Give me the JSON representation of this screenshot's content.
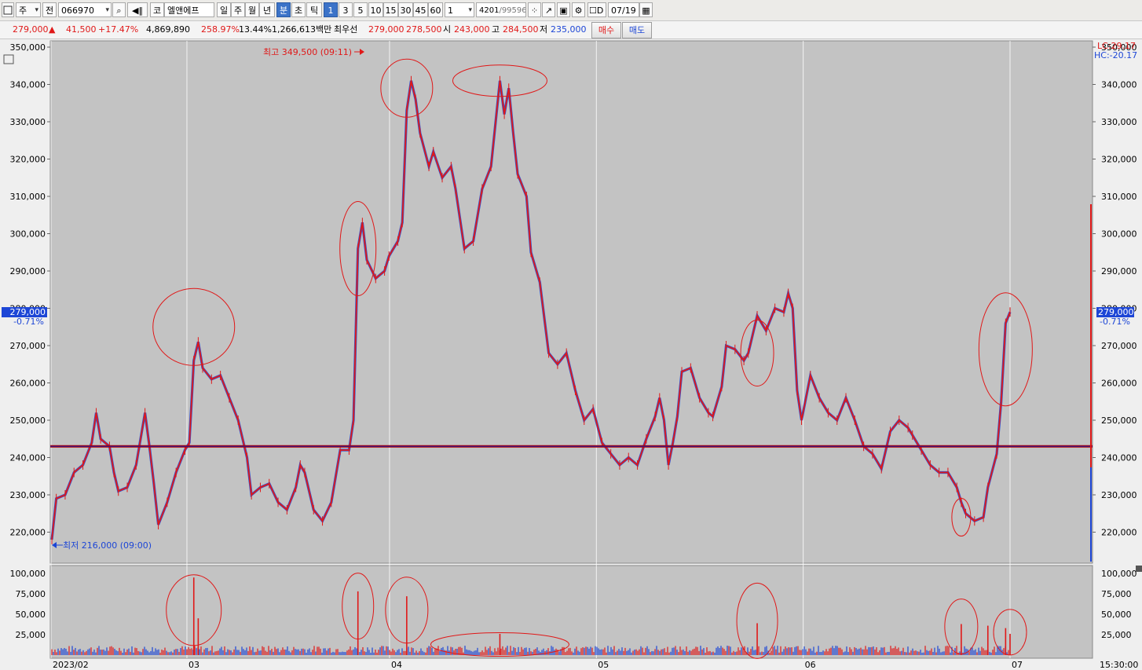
{
  "toolbar": {
    "items": [
      "주",
      "전",
      "066970",
      "코",
      "엘앤에프",
      "일",
      "주",
      "월",
      "년",
      "분",
      "초",
      "틱",
      "1",
      "3",
      "5",
      "10",
      "15",
      "30",
      "45",
      "60",
      "1",
      "4201",
      "/99596",
      "D",
      "07/19"
    ]
  },
  "quote": {
    "price": "279,000",
    "change": "41,500",
    "change_pct": "+17.47%",
    "volume": "4,869,890",
    "vol_ratio": "258.97%",
    "turnover": "13.44%",
    "amount": "1,266,613백만",
    "best_ask_label": "최우선",
    "best_ask": "279,000",
    "best_bid": "278,500",
    "open_label": "시",
    "open": "243,000",
    "high_label": "고",
    "high": "284,500",
    "low_label": "저",
    "low": "235,000",
    "buy_label": "매수",
    "sell_label": "매도"
  },
  "colors": {
    "up": "#e01818",
    "down": "#1d46d6",
    "plot_bg": "#c3c3c3",
    "baseline": "#b00000"
  },
  "chart_data": {
    "type": "line",
    "price_ticks": [
      "350,000",
      "340,000",
      "330,000",
      "320,000",
      "310,000",
      "300,000",
      "290,000",
      "280,000",
      "270,000",
      "260,000",
      "250,000",
      "240,000",
      "230,000",
      "220,000"
    ],
    "volume_ticks": [
      "100,000",
      "75,000",
      "50,000",
      "25,000"
    ],
    "x_ticks": [
      "2023/02",
      "03",
      "04",
      "05",
      "06",
      "07"
    ],
    "time_label": "15:30:00",
    "last_price_tag": "279,000",
    "last_change_tag": "-0.71%",
    "lc_label": "LC:29.17",
    "hc_label": "HC:-20.17",
    "annotation_high": "최고 349,500 (09:11)",
    "annotation_low": "최저 216,000 (09:00)",
    "baseline_price": 243000,
    "ylim": [
      212000,
      352000
    ],
    "price_path": [
      [
        0,
        218000
      ],
      [
        1,
        229000
      ],
      [
        3,
        230000
      ],
      [
        5,
        236000
      ],
      [
        7,
        238000
      ],
      [
        9,
        244000
      ],
      [
        10,
        252000
      ],
      [
        11,
        245000
      ],
      [
        13,
        243000
      ],
      [
        14,
        236000
      ],
      [
        15,
        231000
      ],
      [
        17,
        232000
      ],
      [
        19,
        238000
      ],
      [
        21,
        252000
      ],
      [
        22,
        243000
      ],
      [
        23,
        233000
      ],
      [
        24,
        222000
      ],
      [
        26,
        228000
      ],
      [
        28,
        236000
      ],
      [
        30,
        242000
      ],
      [
        31,
        244000
      ],
      [
        32,
        266000
      ],
      [
        33,
        271000
      ],
      [
        34,
        264000
      ],
      [
        36,
        261000
      ],
      [
        38,
        262000
      ],
      [
        40,
        256000
      ],
      [
        42,
        250000
      ],
      [
        44,
        240000
      ],
      [
        45,
        230000
      ],
      [
        47,
        232000
      ],
      [
        49,
        233000
      ],
      [
        51,
        228000
      ],
      [
        53,
        226000
      ],
      [
        55,
        232000
      ],
      [
        56,
        238000
      ],
      [
        57,
        236000
      ],
      [
        59,
        226000
      ],
      [
        61,
        223000
      ],
      [
        63,
        228000
      ],
      [
        65,
        242000
      ],
      [
        67,
        242000
      ],
      [
        68,
        250000
      ],
      [
        69,
        296000
      ],
      [
        70,
        303000
      ],
      [
        71,
        293000
      ],
      [
        73,
        288000
      ],
      [
        75,
        290000
      ],
      [
        76,
        294000
      ],
      [
        78,
        298000
      ],
      [
        79,
        303000
      ],
      [
        80,
        333000
      ],
      [
        81,
        341000
      ],
      [
        82,
        336000
      ],
      [
        83,
        327000
      ],
      [
        85,
        318000
      ],
      [
        86,
        322000
      ],
      [
        88,
        315000
      ],
      [
        90,
        318000
      ],
      [
        91,
        312000
      ],
      [
        93,
        296000
      ],
      [
        95,
        298000
      ],
      [
        97,
        312000
      ],
      [
        99,
        318000
      ],
      [
        101,
        341000
      ],
      [
        102,
        332000
      ],
      [
        103,
        339000
      ],
      [
        104,
        327000
      ],
      [
        105,
        316000
      ],
      [
        107,
        310000
      ],
      [
        108,
        295000
      ],
      [
        110,
        287000
      ],
      [
        112,
        268000
      ],
      [
        114,
        265000
      ],
      [
        116,
        268000
      ],
      [
        118,
        258000
      ],
      [
        120,
        250000
      ],
      [
        122,
        253000
      ],
      [
        124,
        244000
      ],
      [
        126,
        241000
      ],
      [
        128,
        238000
      ],
      [
        130,
        240000
      ],
      [
        132,
        238000
      ],
      [
        134,
        245000
      ],
      [
        136,
        251000
      ],
      [
        137,
        256000
      ],
      [
        138,
        250000
      ],
      [
        139,
        238000
      ],
      [
        140,
        244000
      ],
      [
        141,
        251000
      ],
      [
        142,
        263000
      ],
      [
        144,
        264000
      ],
      [
        146,
        256000
      ],
      [
        148,
        252000
      ],
      [
        149,
        251000
      ],
      [
        151,
        259000
      ],
      [
        152,
        270000
      ],
      [
        154,
        269000
      ],
      [
        156,
        266000
      ],
      [
        157,
        268000
      ],
      [
        159,
        278000
      ],
      [
        161,
        274000
      ],
      [
        163,
        280000
      ],
      [
        165,
        279000
      ],
      [
        166,
        284000
      ],
      [
        167,
        280000
      ],
      [
        168,
        258000
      ],
      [
        169,
        250000
      ],
      [
        171,
        262000
      ],
      [
        173,
        256000
      ],
      [
        175,
        252000
      ],
      [
        177,
        250000
      ],
      [
        179,
        256000
      ],
      [
        181,
        250000
      ],
      [
        183,
        243000
      ],
      [
        185,
        241000
      ],
      [
        187,
        237000
      ],
      [
        189,
        247000
      ],
      [
        191,
        250000
      ],
      [
        193,
        248000
      ],
      [
        194,
        246000
      ],
      [
        196,
        242000
      ],
      [
        198,
        238000
      ],
      [
        200,
        236000
      ],
      [
        202,
        236000
      ],
      [
        204,
        232000
      ],
      [
        205,
        228000
      ],
      [
        206,
        225000
      ],
      [
        208,
        223000
      ],
      [
        210,
        224000
      ],
      [
        211,
        232000
      ],
      [
        213,
        241000
      ],
      [
        214,
        255000
      ],
      [
        215,
        276000
      ],
      [
        216,
        279000
      ]
    ],
    "volume_spikes": [
      [
        32,
        95000
      ],
      [
        33,
        45000
      ],
      [
        69,
        78000
      ],
      [
        80,
        72000
      ],
      [
        101,
        26000
      ],
      [
        159,
        39000
      ],
      [
        205,
        38000
      ],
      [
        211,
        36000
      ],
      [
        215,
        33000
      ],
      [
        216,
        26000
      ]
    ]
  }
}
